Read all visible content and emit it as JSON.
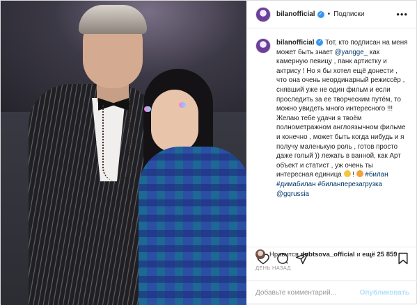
{
  "header": {
    "username": "bilanofficial",
    "separator": "•",
    "follow_label": "Подписки",
    "more_icon": "more-horizontal-icon"
  },
  "caption": {
    "username": "bilanofficial",
    "text_1": "Тот, кто подписан на меня может быть знает ",
    "mention": "@yangge_",
    "text_2": " как камерную певицу , панк артистку и актрису ! Но я бы хотел ещё донести , что она очень неординарный режиссёр , снявший уже не один фильм и если проследить за ее творческим путём, то можно увидеть много интересного !!! Желаю тебе удачи в твоём полнометражном англоязычном фильме и конечно , может быть когда нибудь и я получу маленькую роль , готов просто даже голый )) лежать в ванной, как Арт объект и статист , уж очень ты интересная единица",
    "text_3": " ! ",
    "hashtags": [
      "#билан",
      "#димабилан",
      "#биланперезагрузка"
    ],
    "mention_2": "@gqrussia"
  },
  "likes": {
    "prefix": "Нравится",
    "user": "dubtsova_official",
    "middle": "и",
    "count": "ещё 25 859"
  },
  "date": "ДЕНЬ НАЗАД",
  "comment_box": {
    "placeholder": "Добавьте комментарий...",
    "publish_label": "Опубликовать"
  },
  "colors": {
    "verified": "#3897f0",
    "tag": "#003569",
    "publish_disabled": "#b2dffc",
    "muted": "#999999"
  }
}
